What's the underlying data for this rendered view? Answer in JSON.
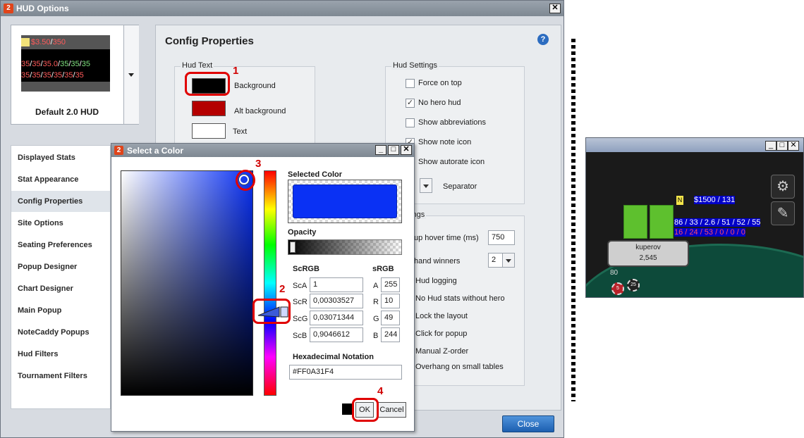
{
  "main_window": {
    "title": "HUD Options",
    "logo": "2"
  },
  "preview": {
    "name": "Default 2.0 HUD",
    "line1": [
      "$3.50",
      "/",
      "350"
    ],
    "line2": [
      "35",
      "/",
      "35",
      "/",
      "35.0",
      "/",
      "35",
      "/",
      "35",
      "/",
      "35"
    ],
    "line3": [
      "35",
      "/",
      "35",
      "/",
      "35",
      "/",
      "35",
      "/",
      "35",
      "/",
      "35"
    ]
  },
  "sidenav": {
    "items": [
      {
        "label": "Displayed Stats"
      },
      {
        "label": "Stat Appearance"
      },
      {
        "label": "Config Properties",
        "active": true
      },
      {
        "label": "Site Options"
      },
      {
        "label": "Seating Preferences"
      },
      {
        "label": "Popup Designer"
      },
      {
        "label": "Chart Designer"
      },
      {
        "label": "Main Popup"
      },
      {
        "label": "NoteCaddy Popups"
      },
      {
        "label": "Hud Filters"
      },
      {
        "label": "Tournament Filters"
      }
    ]
  },
  "config": {
    "title": "Config Properties",
    "help_icon": "?",
    "hud_text": {
      "title": "Hud Text",
      "background_label": "Background",
      "alt_background_label": "Alt background",
      "text_label": "Text",
      "background_color": "#000000",
      "alt_background_color": "#b40000",
      "text_color": "#ffffff"
    },
    "hud_settings": {
      "title": "Hud Settings",
      "options": [
        {
          "label": "Force on top",
          "checked": false
        },
        {
          "label": "No hero hud",
          "checked": true
        },
        {
          "label": "Show abbreviations",
          "checked": false
        },
        {
          "label": "Show note icon",
          "checked": true
        },
        {
          "label": "Show autorate icon",
          "checked": false
        }
      ],
      "separator_label": "Separator"
    },
    "other_settings": {
      "title": "l Settings",
      "hover_label": "up hover time (ms)",
      "hover_value": "750",
      "hand_winners_label": "hand winners",
      "hand_winners_value": "2",
      "options": [
        "Hud logging",
        "No Hud stats without hero",
        "Lock the layout",
        "Click for popup",
        "Manual Z-order",
        "Overhang on small tables"
      ]
    },
    "close_label": "Close"
  },
  "color_dialog": {
    "title": "Select a Color",
    "logo": "2",
    "selected_color_label": "Selected Color",
    "selected_color": "#0a31f4",
    "opacity_label": "Opacity",
    "scrgb_label": "ScRGB",
    "srgb_label": "sRGB",
    "scrgb": {
      "ScA": "1",
      "ScR": "0,00303527",
      "ScG": "0,03071344",
      "ScB": "0,9046612"
    },
    "srgb": {
      "A": "255",
      "R": "10",
      "G": "49",
      "B": "244"
    },
    "hex_label": "Hexadecimal Notation",
    "hex_value": "#FF0A31F4",
    "ok_label": "OK",
    "cancel_label": "Cancel"
  },
  "annotations": [
    "1",
    "2",
    "3",
    "4"
  ],
  "table_preview": {
    "player_name": "kuperov",
    "player_stack": "2,545",
    "bet": "80",
    "chips": [
      "5",
      "25"
    ],
    "hud_line1_prefix": "N",
    "hud_line1": "$1500 / 131",
    "hud_line2": "86 / 33 / 2.6 / 51 / 52 / 55",
    "hud_line3": "16 / 24 / 53 / 0 / 0 / 0"
  }
}
